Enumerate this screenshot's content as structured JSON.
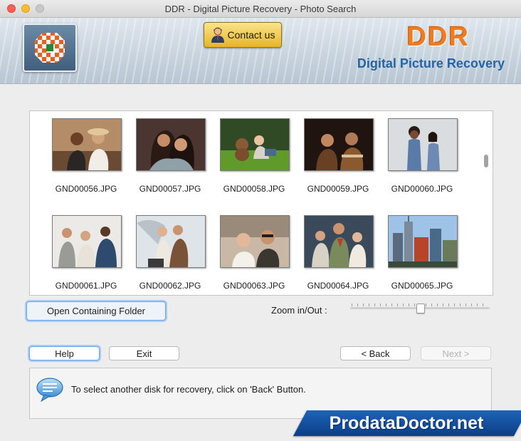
{
  "window": {
    "title": "DDR - Digital Picture Recovery - Photo Search"
  },
  "header": {
    "contact_label": "Contact us",
    "brand": "DDR",
    "subtitle": "Digital Picture Recovery",
    "brand_color": "#f27b1f",
    "subtitle_color": "#2366a8"
  },
  "gallery": {
    "files": [
      "GND00056.JPG",
      "GND00057.JPG",
      "GND00058.JPG",
      "GND00059.JPG",
      "GND00060.JPG",
      "GND00061.JPG",
      "GND00062.JPG",
      "GND00063.JPG",
      "GND00064.JPG",
      "GND00065.JPG"
    ]
  },
  "controls": {
    "open_folder_label": "Open Containing Folder",
    "zoom_label": "Zoom in/Out :",
    "zoom_level": 0.5
  },
  "buttons": {
    "help": "Help",
    "exit": "Exit",
    "back": "< Back",
    "next": "Next >"
  },
  "info": {
    "message": "To select another disk for recovery, click on 'Back' Button.",
    "icon": "speech-bubble-icon"
  },
  "banner": {
    "text": "ProdataDoctor.net"
  }
}
